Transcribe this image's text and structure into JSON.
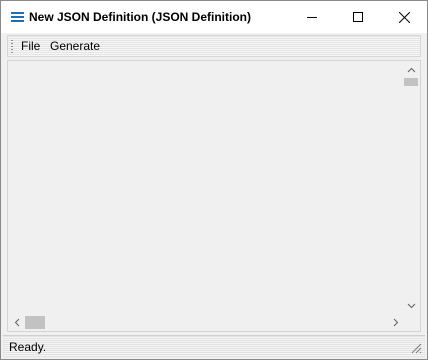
{
  "window": {
    "title": "New JSON Definition (JSON Definition)"
  },
  "icons": {
    "app": "app-icon",
    "minimize": "minimize-icon",
    "maximize": "maximize-icon",
    "close": "close-icon"
  },
  "menu": {
    "items": [
      {
        "label": "File"
      },
      {
        "label": "Generate"
      }
    ]
  },
  "status": {
    "text": "Ready."
  }
}
